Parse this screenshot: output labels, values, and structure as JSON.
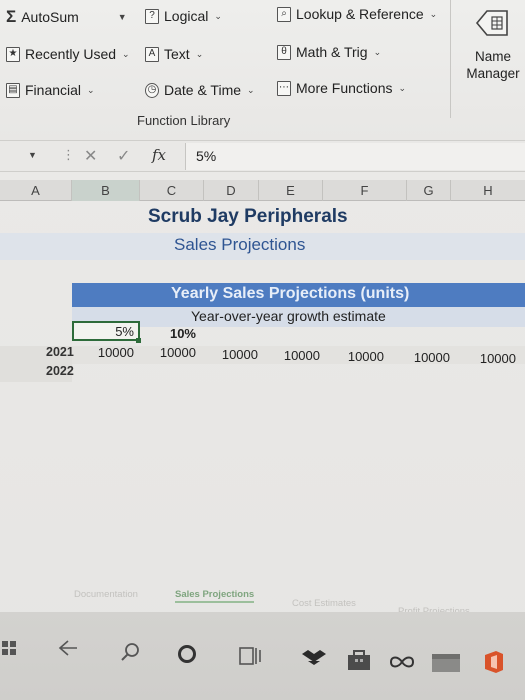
{
  "ribbon": {
    "autosum": "AutoSum",
    "recently_used": "Recently Used",
    "financial": "Financial",
    "logical": "Logical",
    "text": "Text",
    "date_time": "Date & Time",
    "lookup_reference": "Lookup & Reference",
    "math_trig": "Math & Trig",
    "more_functions": "More Functions",
    "name_manager_line1": "Name",
    "name_manager_line2": "Manager",
    "group_label": "Function Library",
    "logical_icon_glyph": "?",
    "text_icon_glyph": "A"
  },
  "formula_bar": {
    "fx_label": "fx",
    "value": "5%"
  },
  "columns": [
    "A",
    "B",
    "C",
    "D",
    "E",
    "F",
    "G",
    "H"
  ],
  "sheet": {
    "title": "Scrub Jay Peripherals",
    "subtitle": "Sales Projections",
    "header": "Yearly Sales Projections (units)",
    "growth_label": "Year-over-year growth estimate",
    "selected_cell_value": "5%",
    "growth_rate": "10%",
    "rows": [
      {
        "year": "2021",
        "values": [
          "10000",
          "10000",
          "10000",
          "10000",
          "10000",
          "10000",
          "10000"
        ]
      },
      {
        "year": "2022",
        "values": []
      }
    ]
  },
  "tabs": [
    {
      "label": "Documentation",
      "active": false
    },
    {
      "label": "Sales Projections",
      "active": true
    },
    {
      "label": "Cost Estimates",
      "active": false
    },
    {
      "label": "Profit Projections",
      "active": false
    }
  ],
  "colors": {
    "title": "#1f3b63",
    "subtitle": "#2f5592",
    "header_band": "#4e7cc1",
    "selection": "#2d6b3a"
  }
}
